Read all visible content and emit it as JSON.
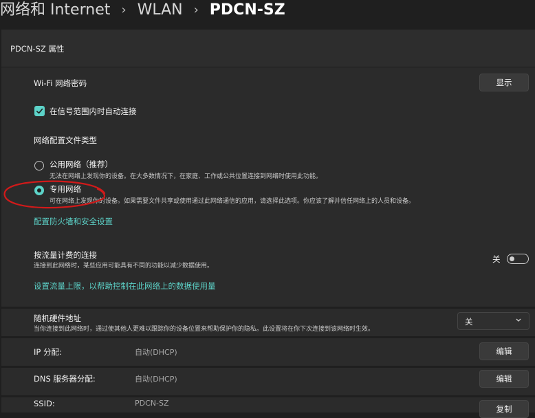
{
  "breadcrumb": {
    "items": [
      "网络和 Internet",
      "WLAN"
    ],
    "current": "PDCN-SZ",
    "separator": "›"
  },
  "panel": {
    "title": "PDCN-SZ 属性"
  },
  "wifi_password": {
    "label": "Wi-Fi 网络密码",
    "button": "显示"
  },
  "auto_connect": {
    "label": "在信号范围内时自动连接",
    "checked": true
  },
  "profile_type": {
    "heading": "网络配置文件类型",
    "public": {
      "label": "公用网络（推荐）",
      "description": "无法在网络上发现你的设备。在大多数情况下，在家庭、工作或公共位置连接到网络时使用此功能。",
      "selected": false
    },
    "private": {
      "label": "专用网络",
      "description": "可在网络上发现你的设备。如果需要文件共享或使用通过此网络通信的应用，请选择此选项。你应该了解并信任网络上的人员和设备。",
      "selected": true
    },
    "firewall_link": "配置防火墙和安全设置"
  },
  "metered": {
    "label": "按流量计费的连接",
    "description": "连接到此网络时，某些应用可能具有不同的功能以减少数据使用。",
    "toggle_label": "关",
    "on": false,
    "link": "设置流量上限，以帮助控制在此网络上的数据使用量"
  },
  "random_mac": {
    "label": "随机硬件地址",
    "description": "当你连接到此网络时，通过使其他人更难以跟踪你的设备位置来帮助保护你的隐私。此设置将在你下次连接到该网络时生效。",
    "value": "关"
  },
  "ip": {
    "label": "IP 分配:",
    "value": "自动(DHCP)",
    "button": "编辑"
  },
  "dns": {
    "label": "DNS 服务器分配:",
    "value": "自动(DHCP)",
    "button": "编辑"
  },
  "ssid": {
    "label": "SSID:",
    "value": "PDCN-SZ",
    "button": "复制"
  },
  "colors": {
    "accent": "#5dd3c9",
    "annotation": "#d11a1a",
    "background": "#1f1f1f",
    "card": "#2b2b2b"
  }
}
